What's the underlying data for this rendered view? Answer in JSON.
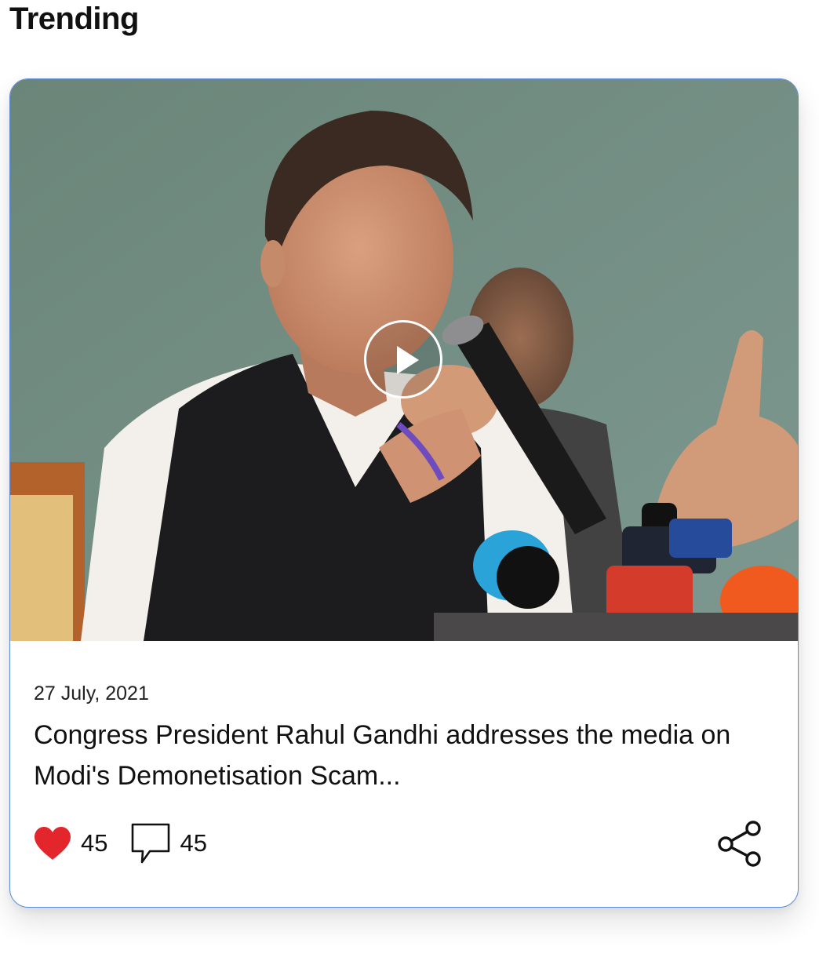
{
  "section": {
    "title": "Trending"
  },
  "card": {
    "date": "27 July, 2021",
    "headline": "Congress President Rahul Gandhi addresses the media on Modi's Demonetisation Scam...",
    "likes": "45",
    "comments": "45"
  },
  "icons": {
    "play": "play-icon",
    "like": "heart-icon",
    "comment": "comment-icon",
    "share": "share-icon"
  },
  "colors": {
    "heart": "#e3262c",
    "card_border": "#5b8bd6",
    "text": "#111111"
  }
}
